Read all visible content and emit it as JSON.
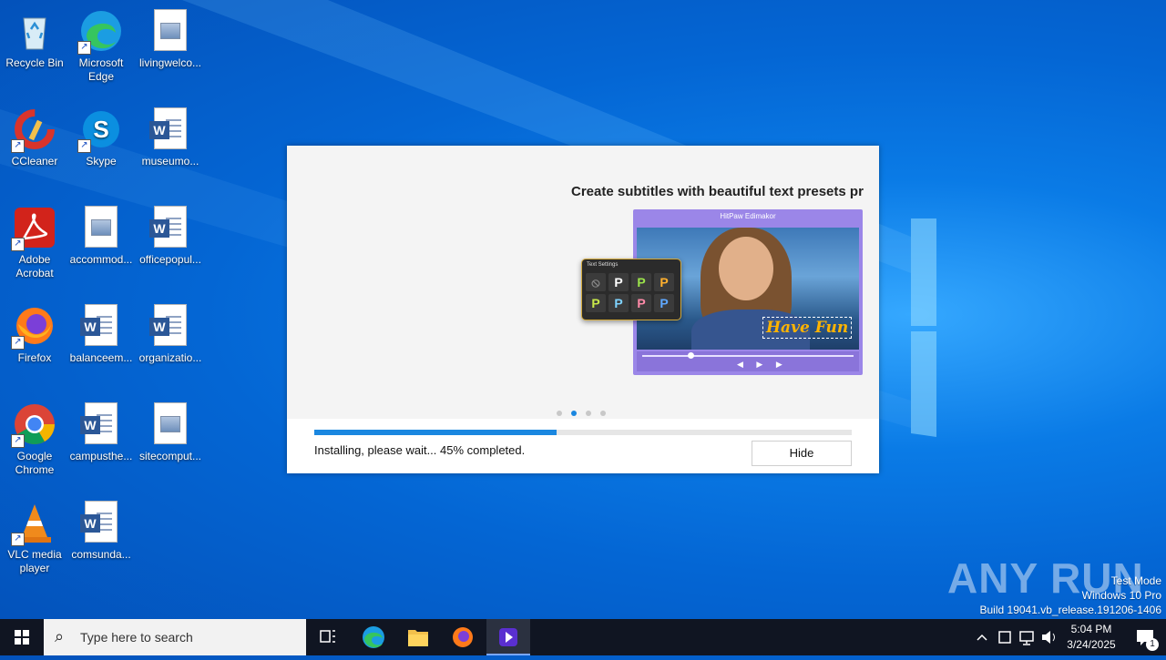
{
  "desktop": {
    "icons": [
      {
        "label": "Recycle Bin"
      },
      {
        "label": "Microsoft Edge"
      },
      {
        "label": "livingwelco..."
      },
      {
        "label": "CCleaner"
      },
      {
        "label": "Skype"
      },
      {
        "label": "museumo..."
      },
      {
        "label": "Adobe Acrobat"
      },
      {
        "label": "accommod..."
      },
      {
        "label": "officepopul..."
      },
      {
        "label": "Firefox"
      },
      {
        "label": "balanceem..."
      },
      {
        "label": "organizatio..."
      },
      {
        "label": "Google Chrome"
      },
      {
        "label": "campusthe..."
      },
      {
        "label": "sitecomput..."
      },
      {
        "label": "VLC media player"
      },
      {
        "label": "comsunda..."
      }
    ]
  },
  "installer": {
    "slide_title": "Create subtitles with beautiful text presets pr",
    "preview_app_title": "HitPaw Edimakor",
    "text_settings_title": "Text Settings",
    "caption_text": "Have Fun",
    "preset_glyphs": [
      "⦸",
      "P",
      "P",
      "P",
      "P",
      "P",
      "P",
      "P"
    ],
    "preset_colors": [
      "#888888",
      "#ffffff",
      "#9be34a",
      "#ffb02e",
      "#c8e84a",
      "#7fd3ff",
      "#ff8aa8",
      "#5fa8ff"
    ],
    "slide_count": 4,
    "active_slide": 2,
    "progress_percent": 45,
    "status_text": "Installing, please wait... 45% completed.",
    "hide_label": "Hide"
  },
  "watermark": {
    "brand": "ANY RUN",
    "mode": "Test Mode",
    "edition": "Windows 10 Pro",
    "build": "Build 19041.vb_release.191206-1406"
  },
  "taskbar": {
    "search_placeholder": "Type here to search",
    "time": "5:04 PM",
    "date": "3/24/2025",
    "notification_count": "1"
  }
}
